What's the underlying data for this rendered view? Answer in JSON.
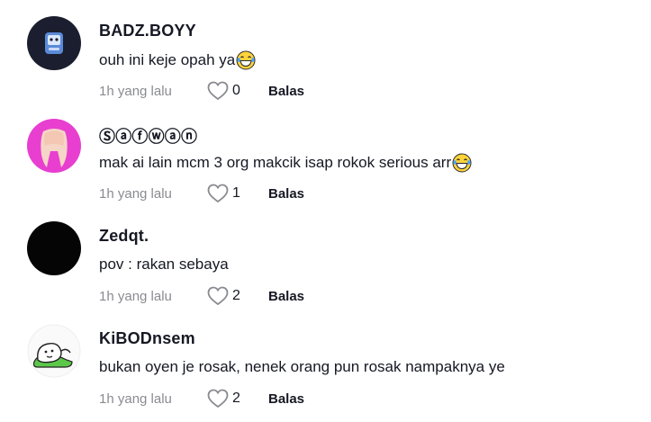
{
  "comments": [
    {
      "username": "Badz.Boyy",
      "username_display": "BADZ.BOYY",
      "text": "ouh ini keje opah ya",
      "emoji": "tears-of-joy-emoji",
      "time": "1h yang lalu",
      "likes": "0",
      "reply_label": "Balas",
      "avatar": "robot-avatar"
    },
    {
      "username": "Ⓢⓐⓕⓦⓐⓝ",
      "text": "mak ai lain mcm 3 org makcik isap rokok serious arr",
      "emoji": "tears-of-joy-emoji",
      "time": "1h yang lalu",
      "likes": "1",
      "reply_label": "Balas",
      "avatar": "pink-hair-avatar"
    },
    {
      "username": "Zedqt.",
      "text": "pov : rakan sebaya",
      "time": "1h yang lalu",
      "likes": "2",
      "reply_label": "Balas",
      "avatar": "black-avatar"
    },
    {
      "username": "KiBODnsem",
      "text": "bukan oyen je rosak, nenek orang pun rosak nampaknya ye",
      "time": "1h yang lalu",
      "likes": "2",
      "reply_label": "Balas",
      "avatar": "cartoon-avatar"
    }
  ],
  "colors": {
    "text": "#161823",
    "muted": "#8a8b91",
    "background": "#ffffff"
  }
}
